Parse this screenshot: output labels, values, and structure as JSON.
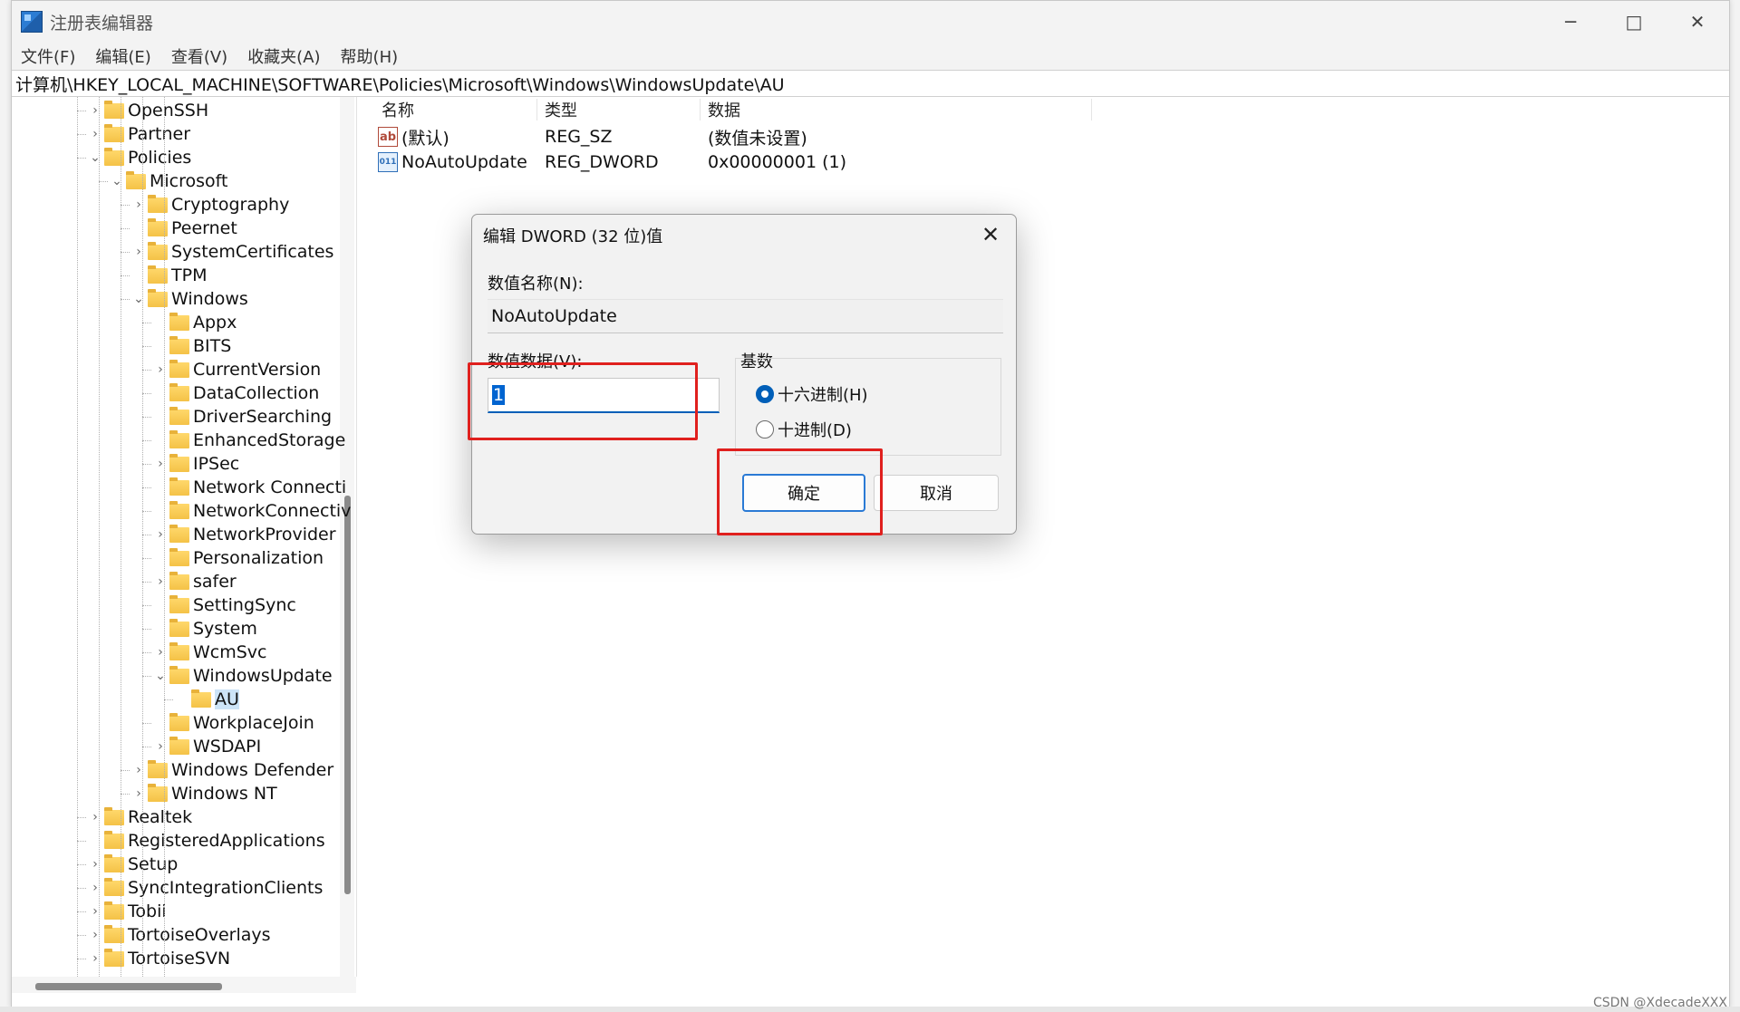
{
  "window": {
    "title": "注册表编辑器",
    "menu": [
      "文件(F)",
      "编辑(E)",
      "查看(V)",
      "收藏夹(A)",
      "帮助(H)"
    ],
    "controls": [
      "─",
      "□",
      "✕"
    ]
  },
  "address": "计算机\\HKEY_LOCAL_MACHINE\\SOFTWARE\\Policies\\Microsoft\\Windows\\WindowsUpdate\\AU",
  "tree": [
    {
      "label": "OpenSSH",
      "level": 0,
      "chevron": "›"
    },
    {
      "label": "Partner",
      "level": 0,
      "chevron": "›"
    },
    {
      "label": "Policies",
      "level": 0,
      "chevron": "⌄"
    },
    {
      "label": "Microsoft",
      "level": 1,
      "chevron": "⌄"
    },
    {
      "label": "Cryptography",
      "level": 2,
      "chevron": "›"
    },
    {
      "label": "Peernet",
      "level": 2,
      "chevron": ""
    },
    {
      "label": "SystemCertificates",
      "level": 2,
      "chevron": "›"
    },
    {
      "label": "TPM",
      "level": 2,
      "chevron": ""
    },
    {
      "label": "Windows",
      "level": 2,
      "chevron": "⌄"
    },
    {
      "label": "Appx",
      "level": 3,
      "chevron": ""
    },
    {
      "label": "BITS",
      "level": 3,
      "chevron": ""
    },
    {
      "label": "CurrentVersion",
      "level": 3,
      "chevron": "›"
    },
    {
      "label": "DataCollection",
      "level": 3,
      "chevron": ""
    },
    {
      "label": "DriverSearching",
      "level": 3,
      "chevron": ""
    },
    {
      "label": "EnhancedStorage",
      "level": 3,
      "chevron": ""
    },
    {
      "label": "IPSec",
      "level": 3,
      "chevron": "›"
    },
    {
      "label": "Network Connecti",
      "level": 3,
      "chevron": ""
    },
    {
      "label": "NetworkConnectiv",
      "level": 3,
      "chevron": ""
    },
    {
      "label": "NetworkProvider",
      "level": 3,
      "chevron": "›"
    },
    {
      "label": "Personalization",
      "level": 3,
      "chevron": ""
    },
    {
      "label": "safer",
      "level": 3,
      "chevron": "›"
    },
    {
      "label": "SettingSync",
      "level": 3,
      "chevron": ""
    },
    {
      "label": "System",
      "level": 3,
      "chevron": ""
    },
    {
      "label": "WcmSvc",
      "level": 3,
      "chevron": "›"
    },
    {
      "label": "WindowsUpdate",
      "level": 3,
      "chevron": "⌄"
    },
    {
      "label": "AU",
      "level": 4,
      "chevron": "",
      "selected": true
    },
    {
      "label": "WorkplaceJoin",
      "level": 3,
      "chevron": ""
    },
    {
      "label": "WSDAPI",
      "level": 3,
      "chevron": "›"
    },
    {
      "label": "Windows Defender",
      "level": 2,
      "chevron": "›"
    },
    {
      "label": "Windows NT",
      "level": 2,
      "chevron": "›"
    },
    {
      "label": "Realtek",
      "level": 0,
      "chevron": "›"
    },
    {
      "label": "RegisteredApplications",
      "level": 0,
      "chevron": ""
    },
    {
      "label": "Setup",
      "level": 0,
      "chevron": "›"
    },
    {
      "label": "SyncIntegrationClients",
      "level": 0,
      "chevron": "›"
    },
    {
      "label": "Tobii",
      "level": 0,
      "chevron": "›"
    },
    {
      "label": "TortoiseOverlays",
      "level": 0,
      "chevron": "›"
    },
    {
      "label": "TortoiseSVN",
      "level": 0,
      "chevron": "›"
    }
  ],
  "list": {
    "headers": {
      "name": "名称",
      "type": "类型",
      "data": "数据"
    },
    "rows": [
      {
        "icon": "string-value-icon",
        "icon_text": "ab",
        "name": "(默认)",
        "type": "REG_SZ",
        "data": "(数值未设置)"
      },
      {
        "icon": "binary-value-icon",
        "icon_text": "011",
        "name": "NoAutoUpdate",
        "type": "REG_DWORD",
        "data": "0x00000001 (1)"
      }
    ]
  },
  "dialog": {
    "title": "编辑 DWORD (32 位)值",
    "name_label": "数值名称(N):",
    "name_value": "NoAutoUpdate",
    "data_label": "数值数据(V):",
    "data_value": "1",
    "base_label": "基数",
    "radio_hex": "十六进制(H)",
    "radio_dec": "十进制(D)",
    "selected_base": "hex",
    "ok": "确定",
    "cancel": "取消"
  },
  "watermark": "CSDN @XdecadeXXX",
  "colors": {
    "accent": "#005fb8",
    "highlight": "#e0201e",
    "folder": "#f4c247"
  }
}
